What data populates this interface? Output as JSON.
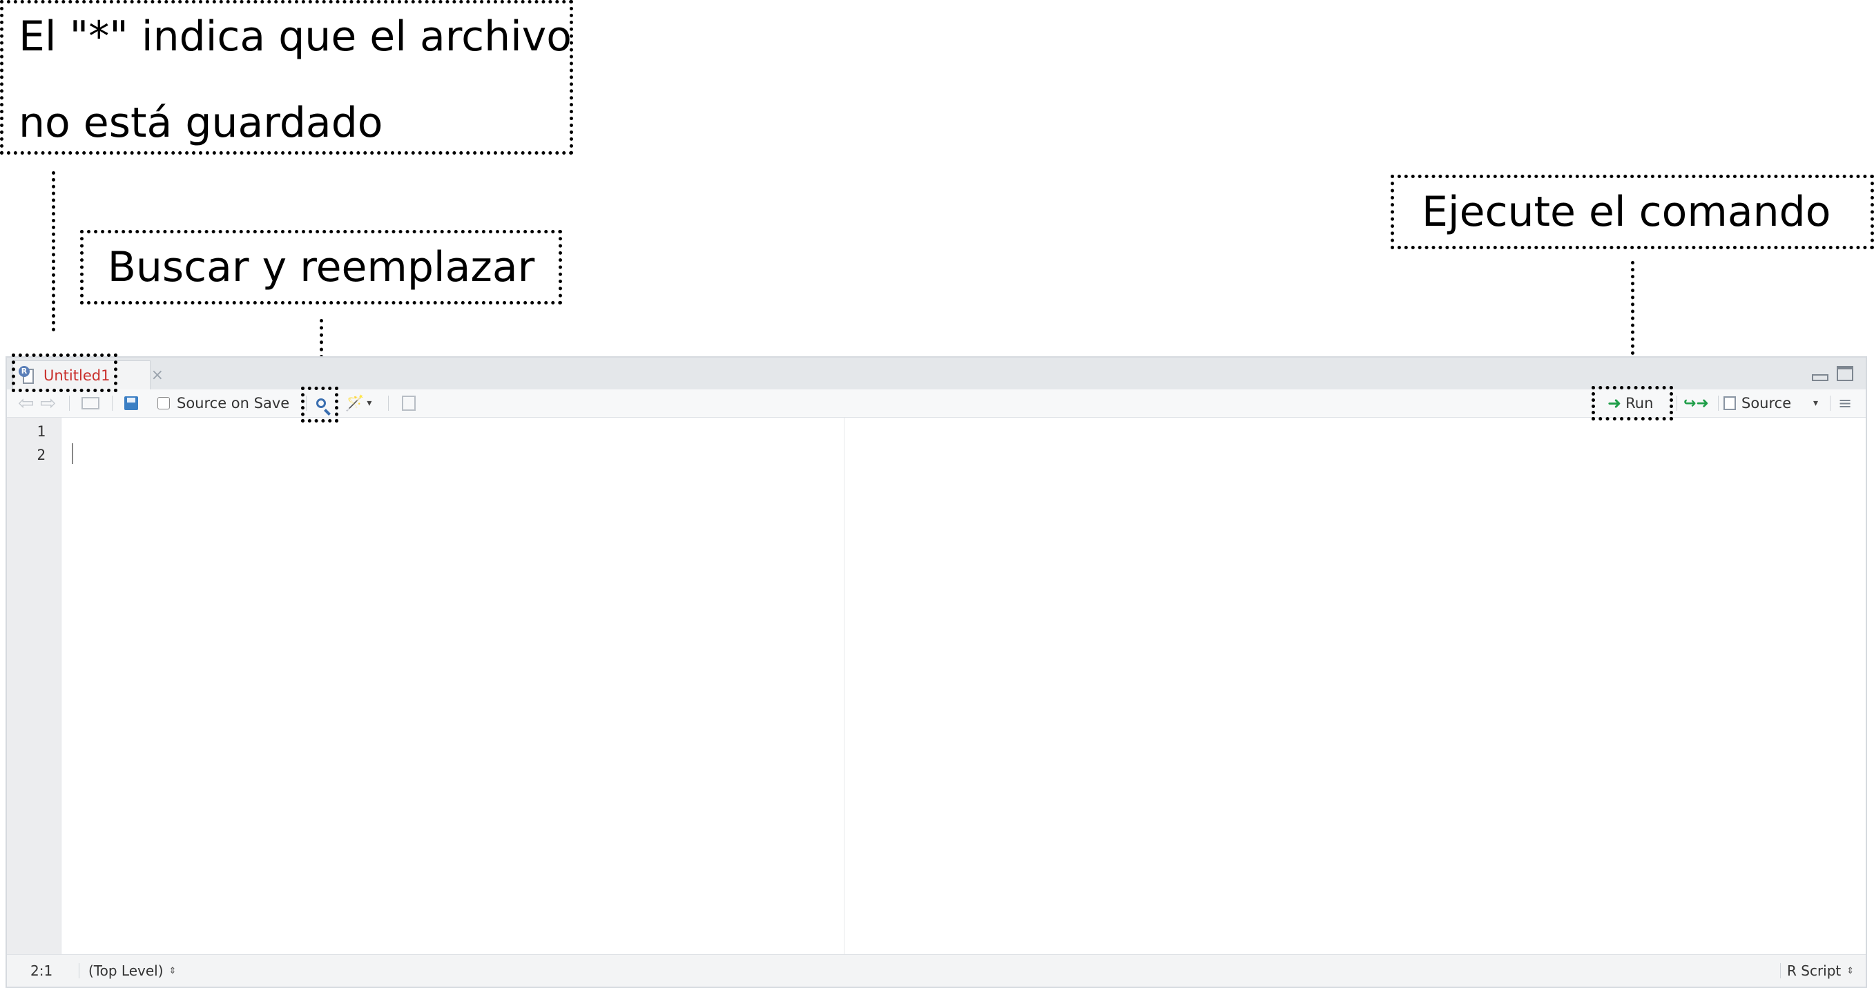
{
  "annotations": {
    "unsaved_line1": "El \"*\" indica que el archivo",
    "unsaved_line2": "no está guardado",
    "find_replace": "Buscar y reemplazar",
    "run_command": "Ejecute el comando"
  },
  "tab": {
    "name": "Untitled1",
    "close": "×"
  },
  "toolbar": {
    "back": "⇦",
    "forward": "⇨",
    "source_on_save": "Source on Save",
    "wand": "🪄",
    "run_label": "Run",
    "rerun": "↪➜",
    "source_label": "Source",
    "dropdown": "▾",
    "outline": "≡"
  },
  "editor": {
    "line_numbers": [
      "1",
      "2"
    ]
  },
  "status": {
    "position": "2:1",
    "scope": "(Top Level)",
    "file_type": "R Script",
    "updown": "⇕"
  },
  "icons": {
    "save": "save-icon",
    "search": "search-icon",
    "run": "run-arrow-icon",
    "source": "source-doc-icon"
  },
  "colors": {
    "tab_name": "#c9302c",
    "run_arrow": "#1e9e48",
    "accent_blue": "#3b7fc4"
  }
}
